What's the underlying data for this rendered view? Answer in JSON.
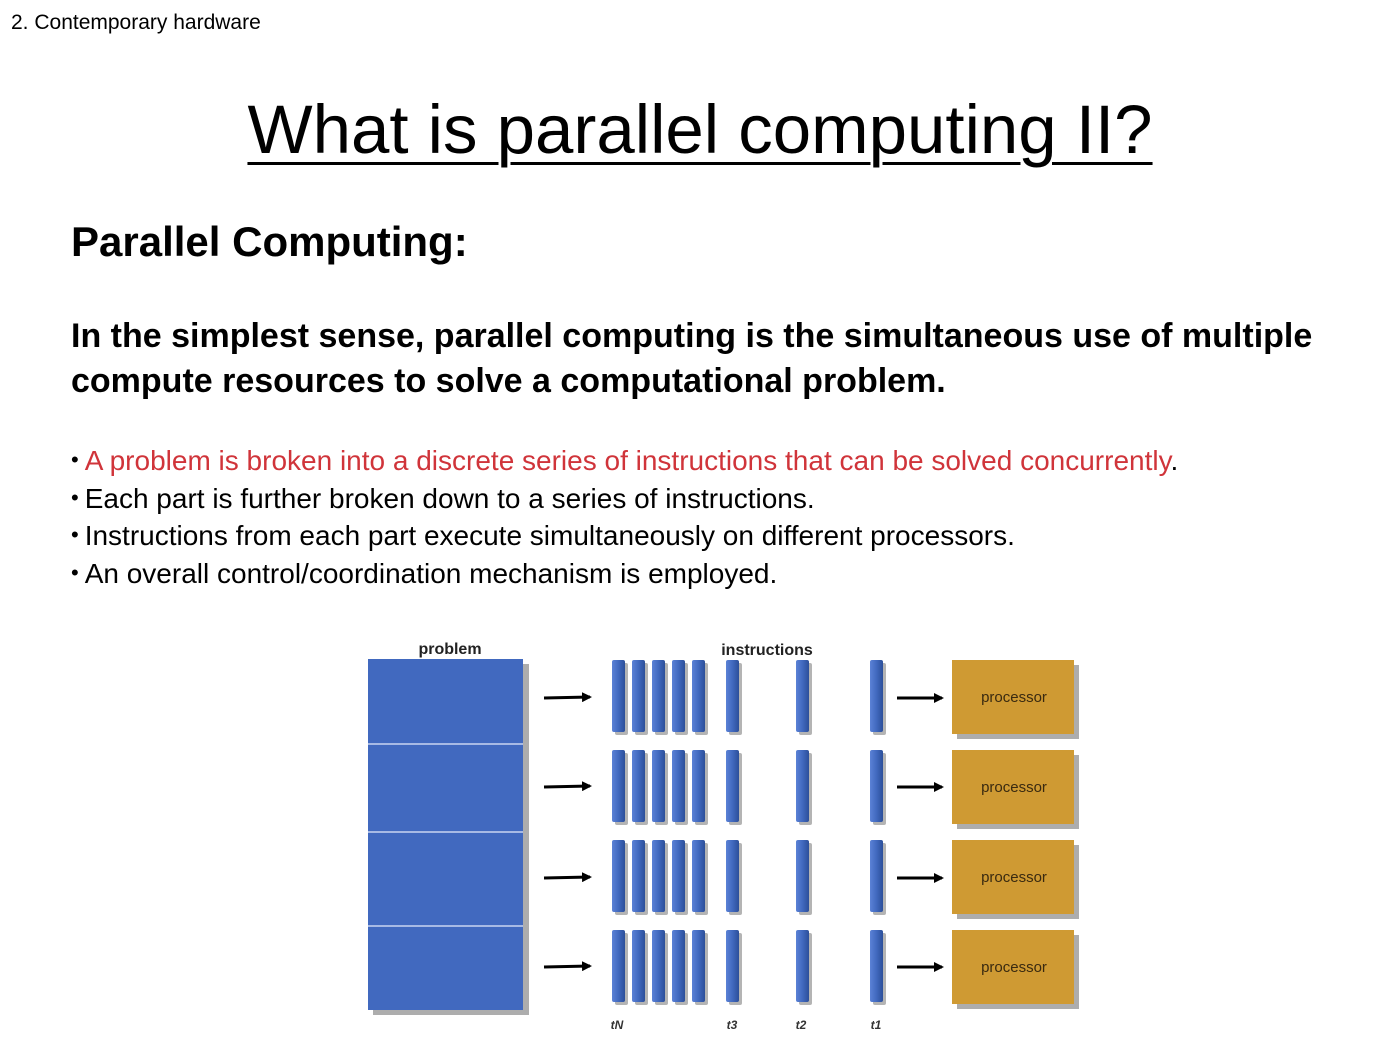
{
  "header": {
    "section": "2. Contemporary hardware",
    "title": "What is parallel computing II?"
  },
  "content": {
    "subheading": "Parallel Computing:",
    "definition": "In the simplest sense, parallel computing is the simultaneous use of multiple compute resources to solve a computational problem.",
    "bullets": [
      {
        "highlight": "A problem is broken into a discrete series of instructions that can be solved concurrently",
        "suffix": "."
      },
      {
        "text": "Each part is further broken down to a series of instructions."
      },
      {
        "text": "Instructions from each part execute simultaneously on different processors."
      },
      {
        "text": "An overall control/coordination mechanism is employed."
      }
    ]
  },
  "diagram": {
    "problem_label": "problem",
    "instructions_label": "instructions",
    "processor_labels": [
      "processor",
      "processor",
      "processor",
      "processor"
    ],
    "time_labels": [
      "tN",
      "t3",
      "t2",
      "t1"
    ],
    "row_count": 4,
    "colors": {
      "problem": "#4169bf",
      "instruction": "#4169bf",
      "processor": "#cf9a33",
      "arrow": "#000000",
      "shadow": "#777777"
    }
  }
}
